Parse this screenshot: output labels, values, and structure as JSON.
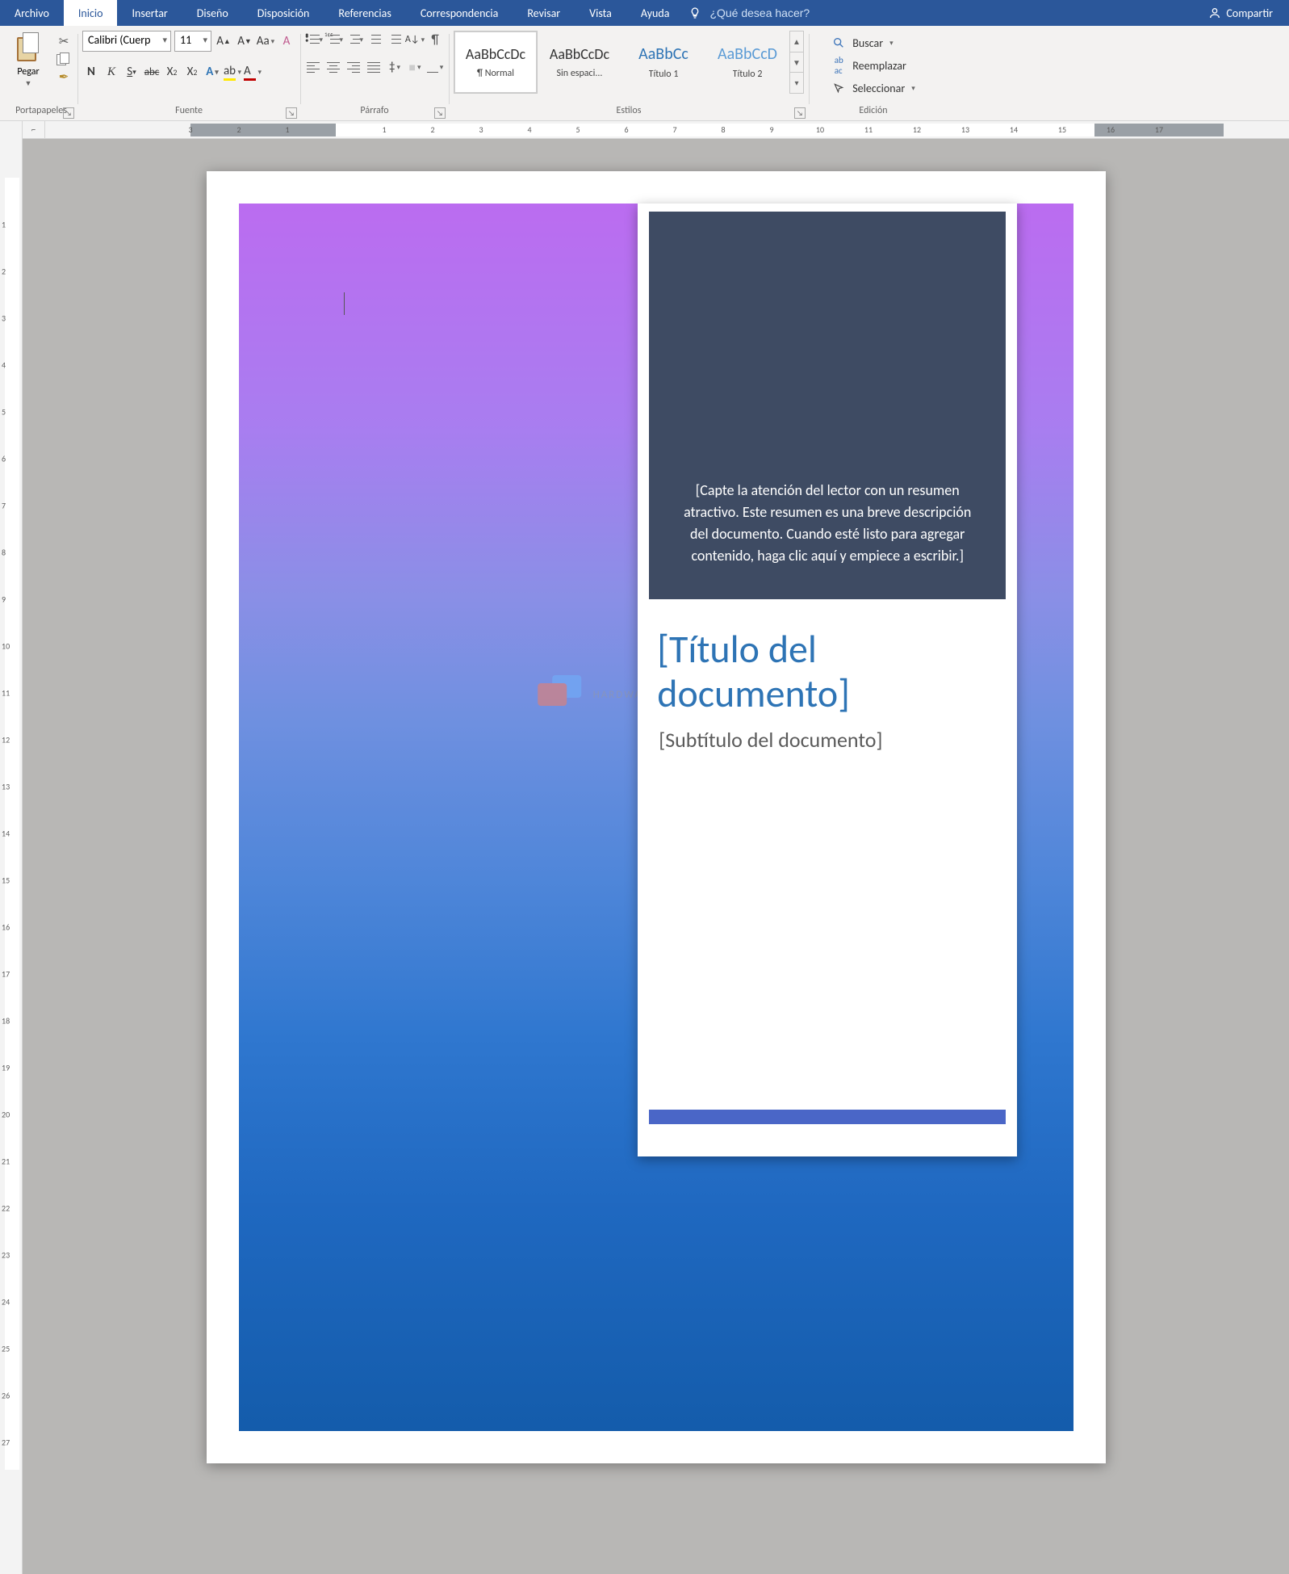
{
  "menu": {
    "tabs": [
      "Archivo",
      "Inicio",
      "Insertar",
      "Diseño",
      "Disposición",
      "Referencias",
      "Correspondencia",
      "Revisar",
      "Vista",
      "Ayuda"
    ],
    "active_index": 1,
    "tellme_placeholder": "¿Qué desea hacer?",
    "share": "Compartir"
  },
  "ribbon": {
    "clipboard": {
      "paste": "Pegar",
      "group_label": "Portapapeles"
    },
    "font": {
      "name": "Calibri (Cuerp",
      "size": "11",
      "group_label": "Fuente",
      "buttons": {
        "b": "N",
        "i": "K",
        "u": "S",
        "abc": "abc",
        "x2": "X",
        "x2s": "2",
        "x2u": "2"
      }
    },
    "paragraph": {
      "group_label": "Párrafo"
    },
    "styles": {
      "group_label": "Estilos",
      "items": [
        {
          "sample": "AaBbCcDc",
          "name": "¶ Normal",
          "sel": true,
          "cls": ""
        },
        {
          "sample": "AaBbCcDc",
          "name": "Sin espaci...",
          "sel": false,
          "cls": ""
        },
        {
          "sample": "AaBbCc",
          "name": "Título 1",
          "sel": false,
          "cls": "h1"
        },
        {
          "sample": "AaBbCcD",
          "name": "Título 2",
          "sel": false,
          "cls": "h2"
        }
      ]
    },
    "editing": {
      "group_label": "Edición",
      "find": "Buscar",
      "replace": "Reemplazar",
      "select": "Seleccionar"
    }
  },
  "ruler": {
    "h_numbers": [
      "3",
      "2",
      "1",
      "1",
      "2",
      "3",
      "4",
      "5",
      "6",
      "7",
      "8",
      "9",
      "10",
      "11",
      "12",
      "13",
      "14",
      "15",
      "16",
      "17"
    ],
    "tab_corner": "⌐"
  },
  "document": {
    "summary": "[Capte la atención del lector con un resumen atractivo. Este resumen es una breve descripción del documento. Cuando esté listo para agregar contenido, haga clic aquí y empiece a escribir.]",
    "title": "[Título del documento]",
    "subtitle": "[Subtítulo del documento]",
    "watermark": "HARDWARESFERA"
  }
}
